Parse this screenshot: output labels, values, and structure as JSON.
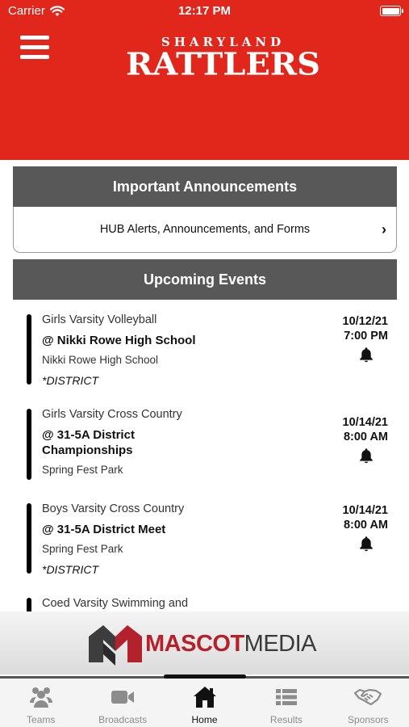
{
  "status": {
    "carrier": "Carrier",
    "time": "12:17 PM"
  },
  "header": {
    "school": "SHARYLAND",
    "mascot": "RATTLERS",
    "brand_color": "#e1261c"
  },
  "announcements": {
    "title": "Important Announcements",
    "row_label": "HUB Alerts, Announcements, and Forms"
  },
  "events": {
    "title": "Upcoming Events",
    "items": [
      {
        "team": "Girls Varsity Volleyball",
        "venue": "@ Nikki Rowe High School",
        "place": "Nikki Rowe High School",
        "tag": "*DISTRICT",
        "date": "10/12/21",
        "time": "7:00 PM"
      },
      {
        "team": "Girls Varsity Cross Country",
        "venue": "@ 31-5A District Championships",
        "place": "Spring Fest Park",
        "tag": "",
        "date": "10/14/21",
        "time": "8:00 AM"
      },
      {
        "team": "Boys Varsity Cross Country",
        "venue": "@ 31-5A District Meet",
        "place": "Spring Fest Park",
        "tag": "*DISTRICT",
        "date": "10/14/21",
        "time": "8:00 AM"
      },
      {
        "team": "Coed Varsity Swimming and"
      }
    ]
  },
  "sponsor": {
    "name_part1": "MASCOT",
    "name_part2": "MEDIA"
  },
  "tabs": [
    {
      "label": "Teams",
      "icon": "people-icon"
    },
    {
      "label": "Broadcasts",
      "icon": "video-camera-icon"
    },
    {
      "label": "Home",
      "icon": "home-icon",
      "active": true
    },
    {
      "label": "Results",
      "icon": "list-icon"
    },
    {
      "label": "Sponsors",
      "icon": "handshake-icon"
    }
  ]
}
